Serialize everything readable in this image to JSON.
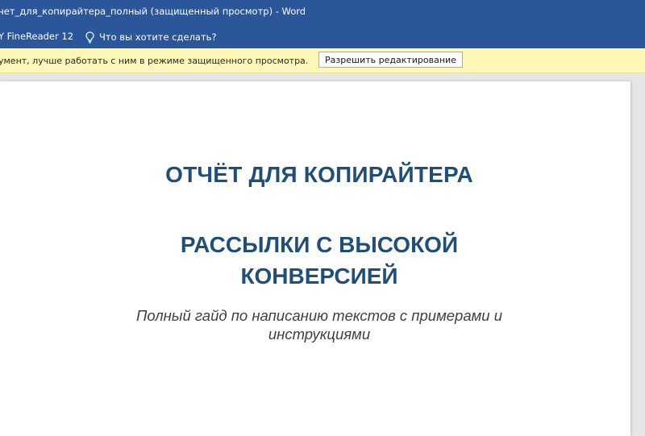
{
  "titlebar": {
    "title": "чет_для_копирайтера_полный (защищенный просмотр)  -  Word"
  },
  "ribbon": {
    "addin_tab": "Y FineReader 12",
    "tell_me": "Что вы хотите сделать?"
  },
  "message_bar": {
    "text": "умент, лучше работать с ним в режиме защищенного просмотра.",
    "enable_editing": "Разрешить редактирование"
  },
  "document": {
    "title": "ОТЧЁТ ДЛЯ КОПИРАЙТЕРА",
    "subtitle_line1": "РАССЫЛКИ С ВЫСОКОЙ",
    "subtitle_line2": "КОНВЕРСИЕЙ",
    "description_line1": "Полный гайд по написанию текстов с примерами и",
    "description_line2": "инструкциями"
  },
  "colors": {
    "titlebar_bg": "#2b579a",
    "message_bar_bg": "#fcf7b6",
    "heading": "#1f4e79"
  },
  "icons": {
    "tell_me": "lightbulb-icon"
  }
}
